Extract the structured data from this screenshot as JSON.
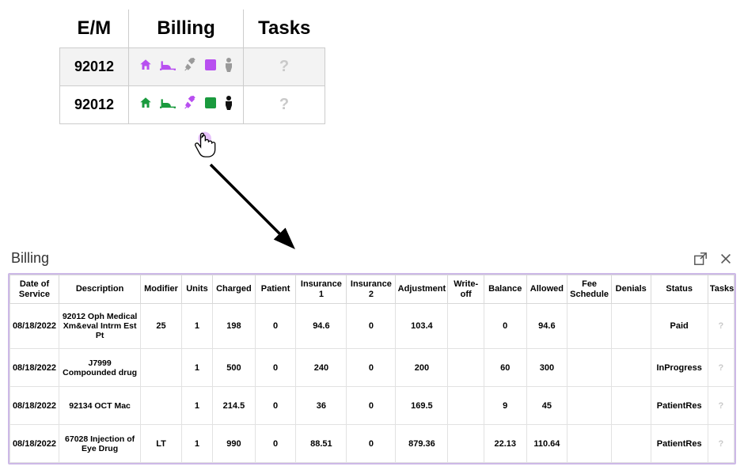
{
  "top": {
    "headers": {
      "em": "E/M",
      "billing": "Billing",
      "tasks": "Tasks"
    },
    "rows": [
      {
        "em": "92012",
        "tasks": "?"
      },
      {
        "em": "92012",
        "tasks": "?"
      }
    ]
  },
  "iconColors": {
    "purple": "#b84ff0",
    "green": "#1a9a3e",
    "gray": "#9a9a9a",
    "black": "#111"
  },
  "panel": {
    "title": "Billing",
    "columns": {
      "dos": "Date of Service",
      "desc": "Description",
      "mod": "Modifier",
      "units": "Units",
      "charged": "Charged",
      "patient": "Patient",
      "ins1": "Insurance 1",
      "ins2": "Insurance 2",
      "adj": "Adjustment",
      "wo": "Write-off",
      "bal": "Balance",
      "allow": "Allowed",
      "fee": "Fee Schedule",
      "den": "Denials",
      "status": "Status",
      "tasks": "Tasks"
    },
    "rows": [
      {
        "dos": "08/18/2022",
        "desc": "92012 Oph Medical Xm&eval Intrm Est Pt",
        "mod": "25",
        "units": "1",
        "charged": "198",
        "patient": "0",
        "ins1": "94.6",
        "ins2": "0",
        "adj": "103.4",
        "wo": "",
        "bal": "0",
        "allow": "94.6",
        "fee": "",
        "den": "",
        "status": "Paid",
        "tasks": "?"
      },
      {
        "dos": "08/18/2022",
        "desc": "J7999 Compounded drug",
        "mod": "",
        "units": "1",
        "charged": "500",
        "patient": "0",
        "ins1": "240",
        "ins2": "0",
        "adj": "200",
        "wo": "",
        "bal": "60",
        "allow": "300",
        "fee": "",
        "den": "",
        "status": "InProgress",
        "tasks": "?"
      },
      {
        "dos": "08/18/2022",
        "desc": "92134 OCT Mac",
        "mod": "",
        "units": "1",
        "charged": "214.5",
        "patient": "0",
        "ins1": "36",
        "ins2": "0",
        "adj": "169.5",
        "wo": "",
        "bal": "9",
        "allow": "45",
        "fee": "",
        "den": "",
        "status": "PatientRes",
        "tasks": "?"
      },
      {
        "dos": "08/18/2022",
        "desc": "67028 Injection of Eye Drug",
        "mod": "LT",
        "units": "1",
        "charged": "990",
        "patient": "0",
        "ins1": "88.51",
        "ins2": "0",
        "adj": "879.36",
        "wo": "",
        "bal": "22.13",
        "allow": "110.64",
        "fee": "",
        "den": "",
        "status": "PatientRes",
        "tasks": "?"
      }
    ]
  }
}
